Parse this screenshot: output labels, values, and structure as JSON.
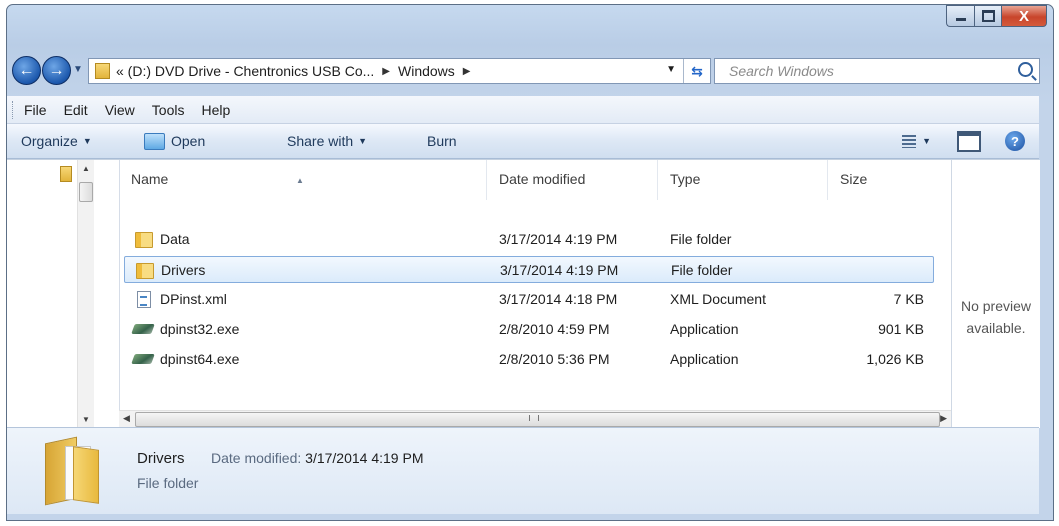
{
  "window": {
    "controls": {
      "minimize": "",
      "maximize": "",
      "close": "X"
    }
  },
  "address": {
    "crumbs": [
      "« (D:) DVD Drive - Chentronics USB Co...",
      "Windows"
    ]
  },
  "search": {
    "placeholder": "Search Windows"
  },
  "menu": [
    {
      "label": "File"
    },
    {
      "label": "Edit"
    },
    {
      "label": "View"
    },
    {
      "label": "Tools"
    },
    {
      "label": "Help"
    }
  ],
  "toolbar": {
    "organize": "Organize",
    "open": "Open",
    "share_with": "Share with",
    "burn": "Burn"
  },
  "columns": {
    "name": "Name",
    "date": "Date modified",
    "type": "Type",
    "size": "Size"
  },
  "files": [
    {
      "name": "Data",
      "date": "3/17/2014 4:19 PM",
      "type": "File folder",
      "size": "",
      "icon": "folder-icon"
    },
    {
      "name": "Drivers",
      "date": "3/17/2014 4:19 PM",
      "type": "File folder",
      "size": "",
      "icon": "folder-icon",
      "selected": true
    },
    {
      "name": "DPinst.xml",
      "date": "3/17/2014 4:18 PM",
      "type": "XML Document",
      "size": "7 KB",
      "icon": "xml-file-icon"
    },
    {
      "name": "dpinst32.exe",
      "date": "2/8/2010 4:59 PM",
      "type": "Application",
      "size": "901 KB",
      "icon": "application-icon"
    },
    {
      "name": "dpinst64.exe",
      "date": "2/8/2010 5:36 PM",
      "type": "Application",
      "size": "1,026 KB",
      "icon": "application-icon"
    }
  ],
  "preview": {
    "line1": "No preview",
    "line2": "available."
  },
  "hscroll": {
    "grip": "III"
  },
  "details": {
    "name": "Drivers",
    "modified_label": "Date modified:",
    "modified_value": "3/17/2014 4:19 PM",
    "type": "File folder"
  }
}
